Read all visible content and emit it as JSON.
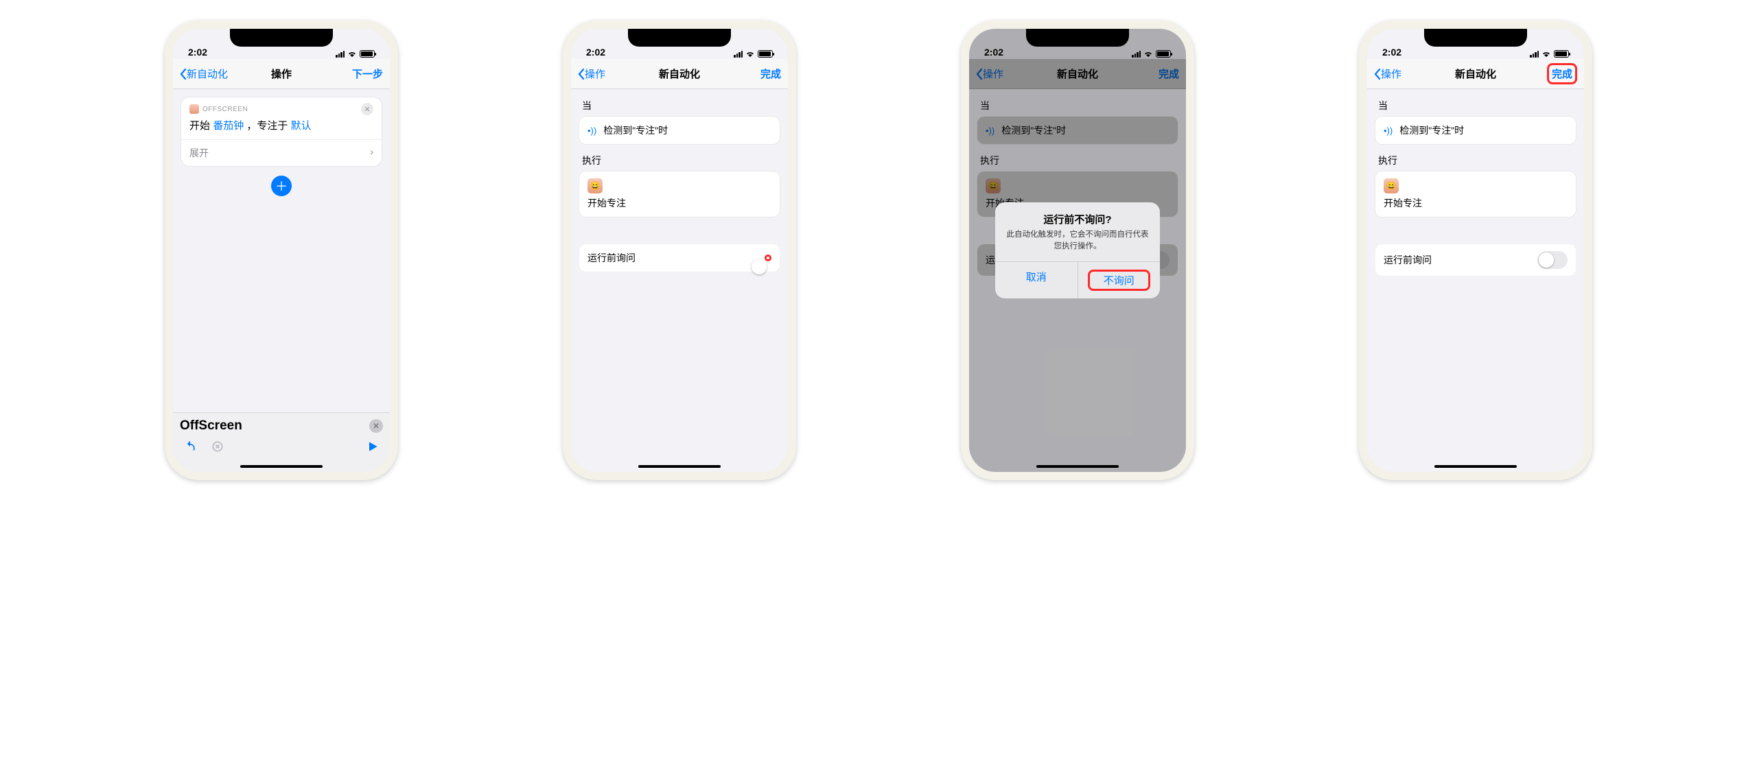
{
  "status": {
    "time": "2:02",
    "loc_glyph": "↗"
  },
  "screen1": {
    "back": "新自动化",
    "title": "操作",
    "next": "下一步",
    "app_label": "OFFSCREEN",
    "action_line": {
      "p1": "开始",
      "p2": "番茄钟",
      "p3": "，专注于",
      "p4": "默认"
    },
    "expand": "展开",
    "search_text": "OffScreen"
  },
  "common": {
    "back": "操作",
    "title": "新自动化",
    "done": "完成",
    "when": "当",
    "trigger": "检测到\"专注\"时",
    "do": "执行",
    "action": "开始专注",
    "ask_label": "运行前询问"
  },
  "alert": {
    "title": "运行前不询问?",
    "msg": "此自动化触发时，它会不询问而自行代表您执行操作。",
    "cancel": "取消",
    "confirm": "不询问"
  }
}
